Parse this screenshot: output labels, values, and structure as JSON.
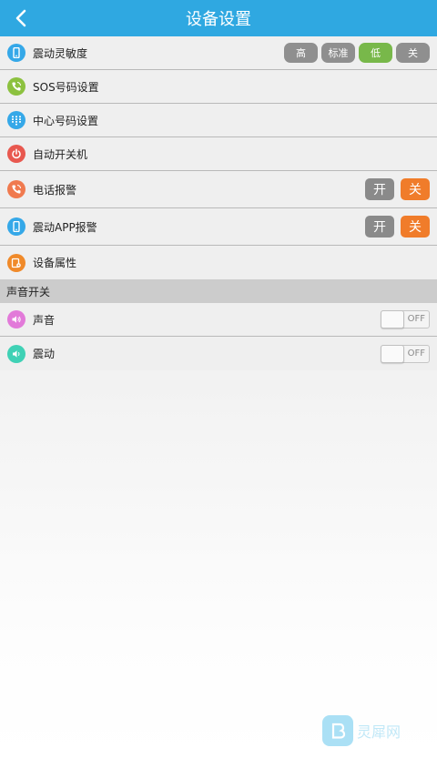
{
  "header": {
    "title": "设备设置",
    "back_icon": "chevron-left-icon"
  },
  "rows": {
    "sensitivity": {
      "label": "震动灵敏度",
      "icon": "phone-icon",
      "icon_color": "#35a8e8",
      "options": [
        "高",
        "标准",
        "低",
        "关"
      ],
      "selected": "低"
    },
    "sos": {
      "label": "SOS号码设置",
      "icon": "phone-call-icon",
      "icon_color": "#8cc13f"
    },
    "center": {
      "label": "中心号码设置",
      "icon": "dialpad-icon",
      "icon_color": "#35a8e8"
    },
    "auto_power": {
      "label": "自动开关机",
      "icon": "power-icon",
      "icon_color": "#e8584f"
    },
    "phone_alarm": {
      "label": "电话报警",
      "icon": "phone-call-icon",
      "icon_color": "#f07a4f",
      "on_label": "开",
      "off_label": "关",
      "value": "关"
    },
    "app_alarm": {
      "label": "震动APP报警",
      "icon": "phone-icon",
      "icon_color": "#35a8e8",
      "on_label": "开",
      "off_label": "关",
      "value": "关"
    },
    "device_props": {
      "label": "设备属性",
      "icon": "device-info-icon",
      "icon_color": "#f08a2a"
    }
  },
  "sound_section": {
    "title": "声音开关",
    "sound": {
      "label": "声音",
      "icon": "speaker-icon",
      "icon_color": "#e27ad9",
      "state": "OFF"
    },
    "vibrate": {
      "label": "震动",
      "icon": "vibrate-icon",
      "icon_color": "#3fd1b5",
      "state": "OFF"
    }
  },
  "watermark": {
    "text": "灵犀网"
  }
}
